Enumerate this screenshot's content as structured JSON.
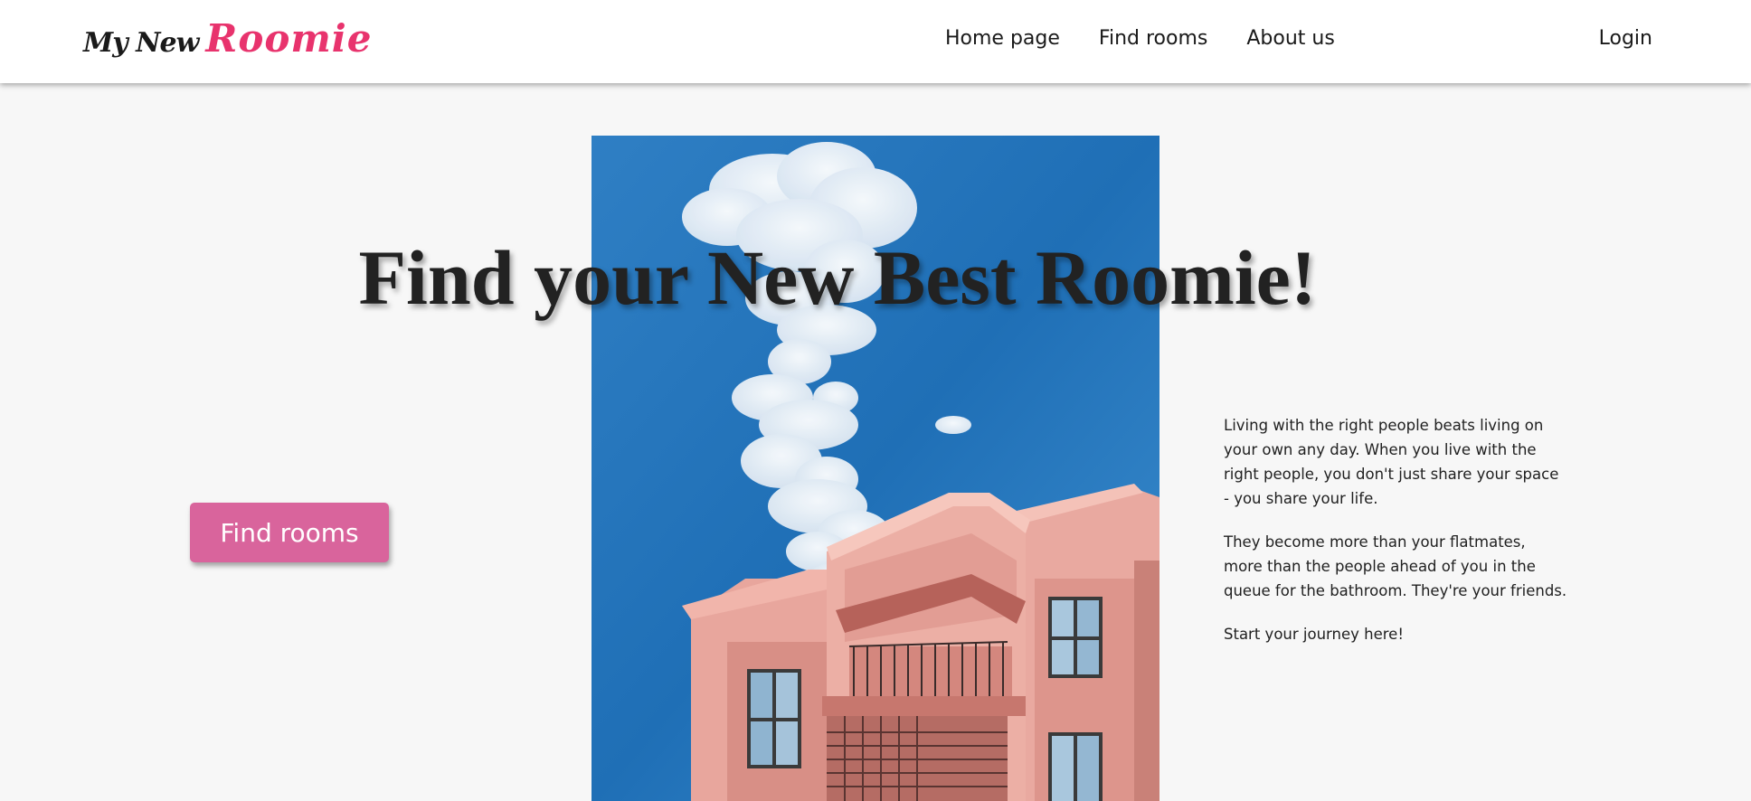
{
  "header": {
    "logo": {
      "part1": "My New",
      "part2": "Roomie"
    },
    "nav": [
      {
        "label": "Home page"
      },
      {
        "label": "Find rooms"
      },
      {
        "label": "About us"
      }
    ],
    "login_label": "Login"
  },
  "hero": {
    "title": "Find your New Best Roomie!",
    "cta_label": "Find rooms",
    "image_icon": "pink-building-against-blue-sky-photo",
    "paragraphs": [
      "Living with the right people beats living on your own any day. When you live with the right people, you don't just share your space - you share your life.",
      "They become more than your flatmates, more than the people ahead of you in the queue for the bathroom. They're your friends.",
      "Start your journey here!"
    ]
  },
  "colors": {
    "accent": "#e8336d",
    "button": "#d9649c",
    "page_background": "#f7f7f7",
    "header_background": "#ffffff"
  }
}
